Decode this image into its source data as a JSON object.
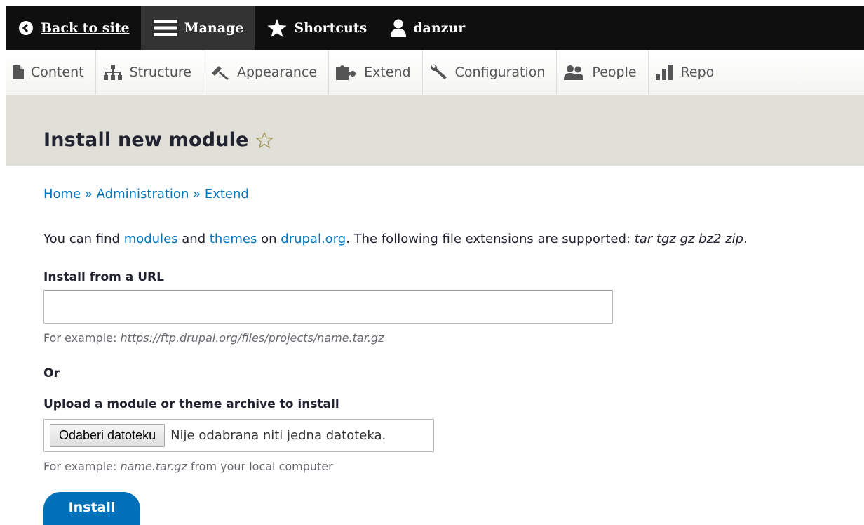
{
  "toolbar": {
    "back_label": "Back to site",
    "manage_label": "Manage",
    "shortcuts_label": "Shortcuts",
    "user_label": "danzur"
  },
  "tray": {
    "items": [
      {
        "label": "Content",
        "icon": "file-icon"
      },
      {
        "label": "Structure",
        "icon": "sitemap-icon"
      },
      {
        "label": "Appearance",
        "icon": "paintbrush-icon"
      },
      {
        "label": "Extend",
        "icon": "puzzle-icon"
      },
      {
        "label": "Configuration",
        "icon": "wrench-icon"
      },
      {
        "label": "People",
        "icon": "people-icon"
      },
      {
        "label": "Repo",
        "icon": "bar-chart-icon"
      }
    ]
  },
  "page": {
    "title": "Install new module"
  },
  "breadcrumb": {
    "items": [
      "Home",
      "Administration",
      "Extend"
    ],
    "separator": "»"
  },
  "intro": {
    "prefix": "You can find ",
    "link_modules": "modules",
    "and": " and ",
    "link_themes": "themes",
    "on": " on ",
    "link_drupal": "drupal.org",
    "suffix": ". The following file extensions are supported: ",
    "extensions": "tar tgz gz bz2 zip",
    "end": "."
  },
  "form": {
    "url_label": "Install from a URL",
    "url_value": "",
    "url_example_prefix": "For example: ",
    "url_example": "https://ftp.drupal.org/files/projects/name.tar.gz",
    "or_label": "Or",
    "upload_label": "Upload a module or theme archive to install",
    "file_button": "Odaberi datoteku",
    "file_status": "Nije odabrana niti jedna datoteka.",
    "upload_example_prefix": "For example: ",
    "upload_example": "name.tar.gz",
    "upload_example_suffix": " from your local computer",
    "submit_label": "Install"
  },
  "colors": {
    "toolbar_bg": "#0f0f0f",
    "header_bg": "#e0e0d8",
    "link": "#0074bd",
    "primary_button": "#0071b8"
  }
}
